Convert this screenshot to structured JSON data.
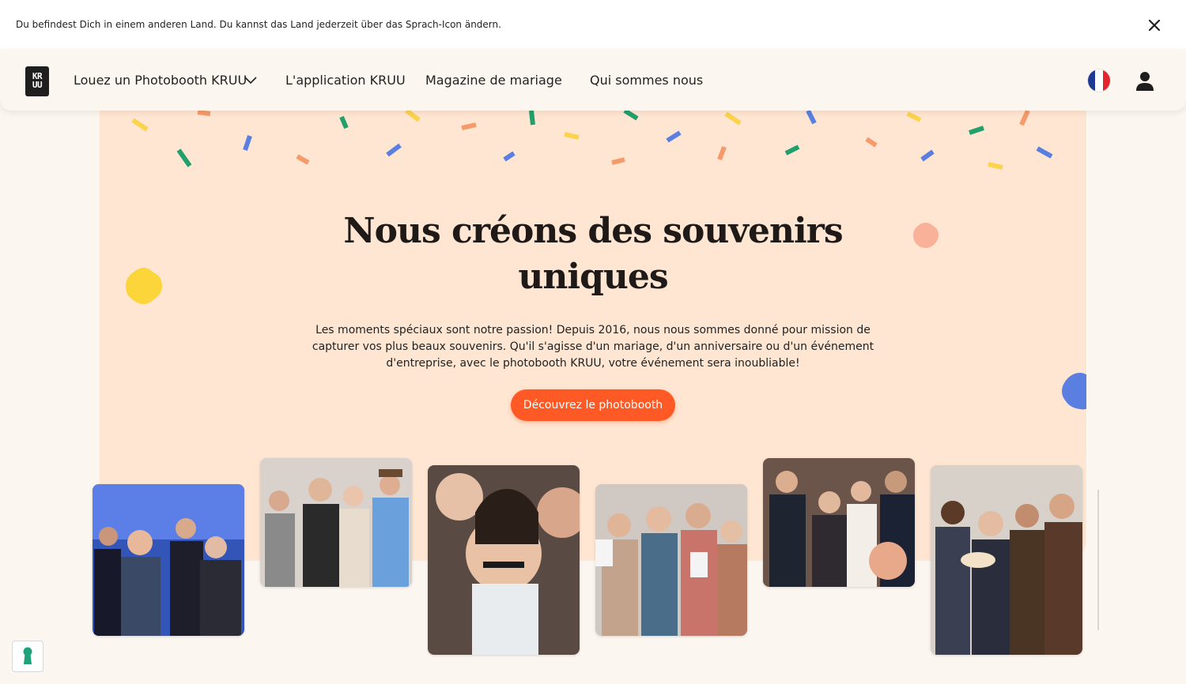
{
  "notice": {
    "text": "Du befindest Dich in einem anderen Land. Du kannst das Land jederzeit über das Sprach-Icon ändern.",
    "close_icon": "close-icon"
  },
  "nav": {
    "logo_text": [
      "KR",
      "UU"
    ],
    "items": [
      {
        "label": "Louez un Photobooth KRUU",
        "has_dropdown": true
      },
      {
        "label": "L'application KRUU"
      },
      {
        "label": "Magazine de mariage"
      },
      {
        "label": "Qui sommes nous"
      }
    ],
    "language_flag": "french-flag-icon",
    "account_icon": "user-icon"
  },
  "hero": {
    "title_line1": "Nous créons des souvenirs",
    "title_line2": "uniques",
    "description": "Les moments spéciaux sont notre passion! Depuis 2016, nous nous sommes donné pour mission de capturer vos plus beaux souvenirs. Qu'il s'agisse d'un mariage, d'un anniversaire ou d'un événement d'entreprise, avec le photobooth KRUU, votre événement sera inoubliable!",
    "cta_label": "Découvrez le photobooth"
  },
  "photos": [
    {
      "name": "party-crowd-photo"
    },
    {
      "name": "group-props-photo"
    },
    {
      "name": "mustache-props-photo"
    },
    {
      "name": "women-printouts-photo"
    },
    {
      "name": "wedding-couple-photo"
    },
    {
      "name": "birthday-cake-photo"
    }
  ],
  "colors": {
    "page_bg": "#fcf6f0",
    "hero_bg": "#ffe6d3",
    "accent": "#ff5a26",
    "confetti_yellow": "#fcd34d",
    "confetti_green": "#22a06b",
    "confetti_blue": "#5b7fe0",
    "confetti_orange": "#f69a6a"
  },
  "cookie_button_icon": "keyhole-icon"
}
